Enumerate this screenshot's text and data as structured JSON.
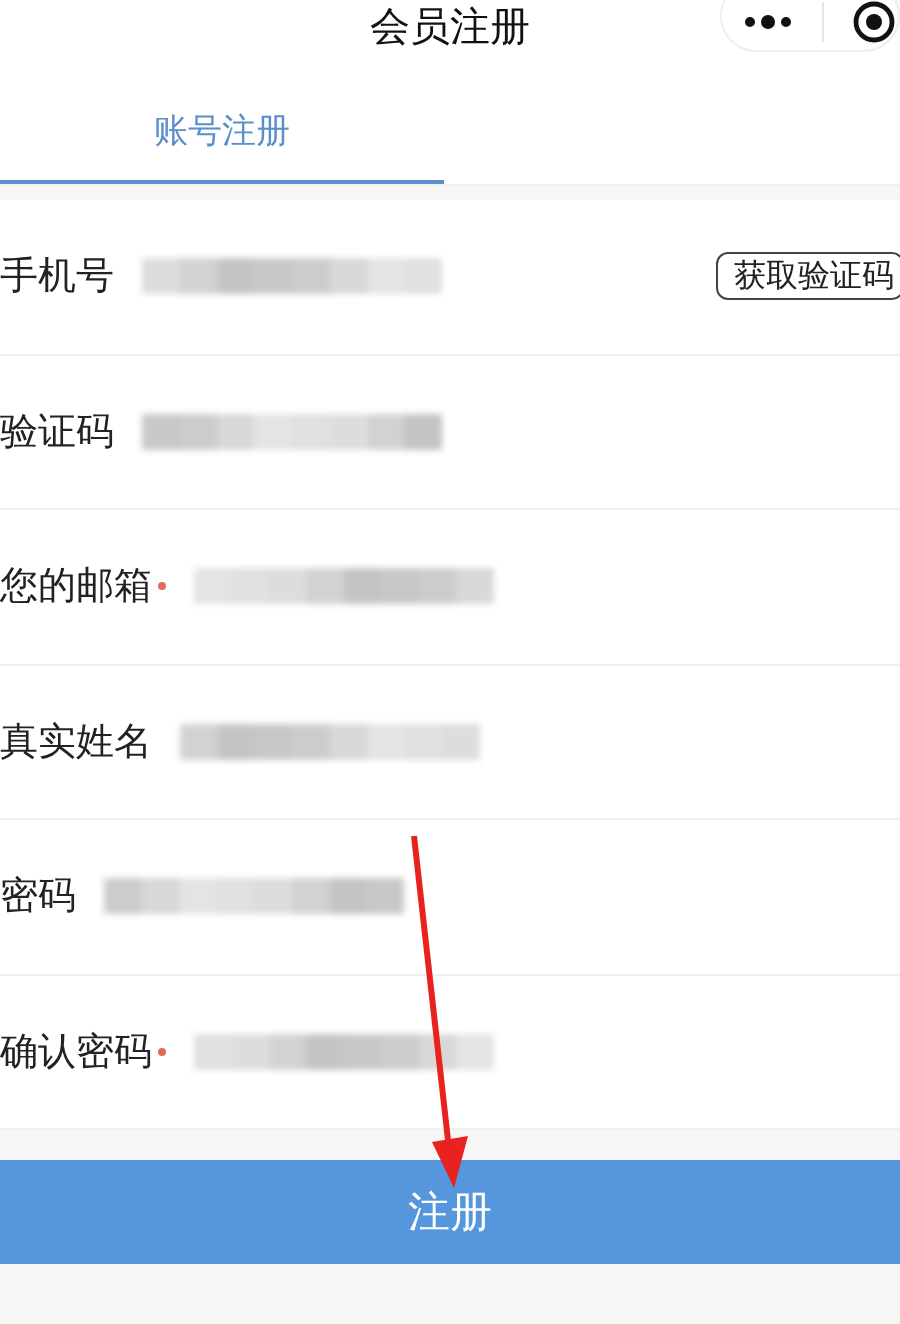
{
  "nav_bar": {
    "title": "会员注册"
  },
  "tabs": [
    {
      "label": "账号注册",
      "selected": true
    }
  ],
  "form_rows": [
    {
      "label": "手机号",
      "required": false,
      "value_hidden": true,
      "action": "获取验证码"
    },
    {
      "label": "验证码",
      "required": false,
      "value_hidden": true
    },
    {
      "label": "您的邮箱",
      "required": true,
      "value_hidden": true
    },
    {
      "label": "真实姓名",
      "required": false,
      "value_hidden": true
    },
    {
      "label": "密码",
      "required": false,
      "value_hidden": true
    },
    {
      "label": "确认密码",
      "required": true,
      "value_hidden": true
    }
  ],
  "submit_button": "注册"
}
